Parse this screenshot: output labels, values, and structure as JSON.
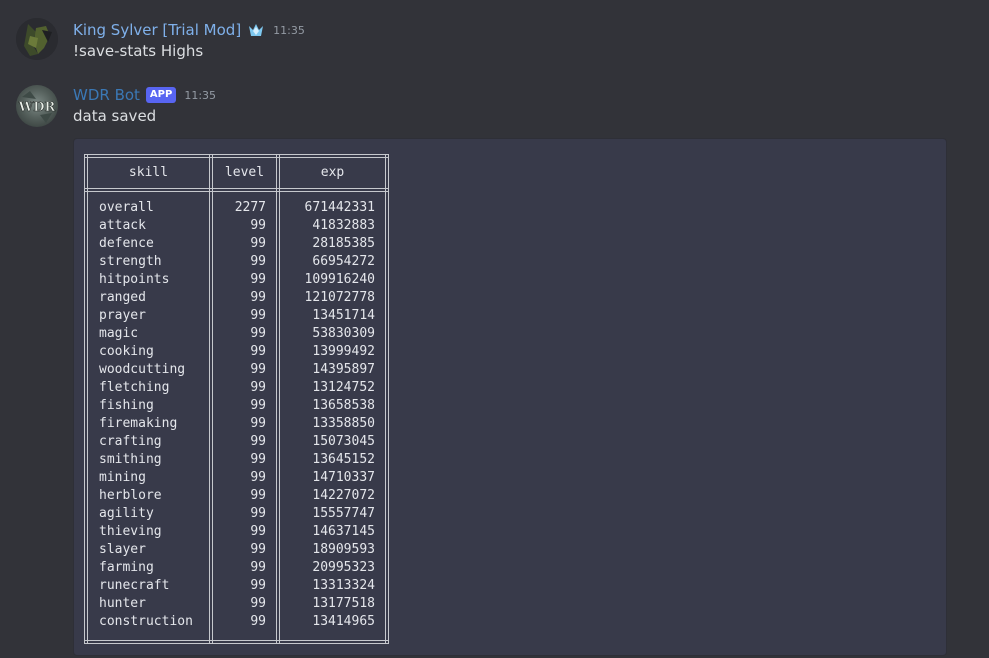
{
  "messages": [
    {
      "author": "King Sylver [Trial Mod]",
      "badge_icon": "crown-icon",
      "timestamp": "11:35",
      "text": "!save-stats Highs"
    },
    {
      "author": "WDR Bot",
      "badge": "APP",
      "timestamp": "11:35",
      "text": "data saved",
      "avatar_text": "WDR"
    }
  ],
  "stats_table": {
    "headers": [
      "skill",
      "level",
      "exp"
    ],
    "rows": [
      {
        "skill": "overall",
        "level": "2277",
        "exp": "671442331"
      },
      {
        "skill": "attack",
        "level": "99",
        "exp": "41832883"
      },
      {
        "skill": "defence",
        "level": "99",
        "exp": "28185385"
      },
      {
        "skill": "strength",
        "level": "99",
        "exp": "66954272"
      },
      {
        "skill": "hitpoints",
        "level": "99",
        "exp": "109916240"
      },
      {
        "skill": "ranged",
        "level": "99",
        "exp": "121072778"
      },
      {
        "skill": "prayer",
        "level": "99",
        "exp": "13451714"
      },
      {
        "skill": "magic",
        "level": "99",
        "exp": "53830309"
      },
      {
        "skill": "cooking",
        "level": "99",
        "exp": "13999492"
      },
      {
        "skill": "woodcutting",
        "level": "99",
        "exp": "14395897"
      },
      {
        "skill": "fletching",
        "level": "99",
        "exp": "13124752"
      },
      {
        "skill": "fishing",
        "level": "99",
        "exp": "13658538"
      },
      {
        "skill": "firemaking",
        "level": "99",
        "exp": "13358850"
      },
      {
        "skill": "crafting",
        "level": "99",
        "exp": "15073045"
      },
      {
        "skill": "smithing",
        "level": "99",
        "exp": "13645152"
      },
      {
        "skill": "mining",
        "level": "99",
        "exp": "14710337"
      },
      {
        "skill": "herblore",
        "level": "99",
        "exp": "14227072"
      },
      {
        "skill": "agility",
        "level": "99",
        "exp": "15557747"
      },
      {
        "skill": "thieving",
        "level": "99",
        "exp": "14637145"
      },
      {
        "skill": "slayer",
        "level": "99",
        "exp": "18909593"
      },
      {
        "skill": "farming",
        "level": "99",
        "exp": "20995323"
      },
      {
        "skill": "runecraft",
        "level": "99",
        "exp": "13313324"
      },
      {
        "skill": "hunter",
        "level": "99",
        "exp": "13177518"
      },
      {
        "skill": "construction",
        "level": "99",
        "exp": "13414965"
      }
    ]
  },
  "colors": {
    "background": "#323339",
    "codeblock": "#383a4a",
    "username_mod": "#7fb0ea",
    "username_bot": "#3b78b5",
    "app_badge": "#5865f2"
  }
}
